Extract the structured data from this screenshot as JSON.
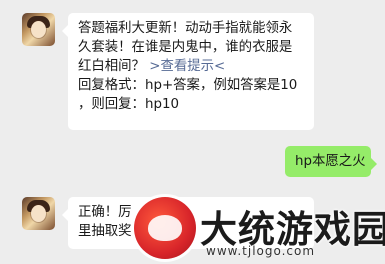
{
  "messages": [
    {
      "sender": "official",
      "lines": [
        "答题福利大更新！动动手指就能领永",
        "久套装！在谁是内鬼中，谁的衣服是",
        "红白相间？",
        "回复格式：hp+答案，例如答案是10",
        "，则回复：hp10"
      ],
      "link_text": ">查看提示<"
    },
    {
      "sender": "me",
      "text": "hp本愿之火"
    },
    {
      "sender": "official",
      "lines": [
        "正确！厉",
        "里抽取奖"
      ]
    }
  ],
  "watermark": {
    "title": "大统游戏园",
    "url": "www.tjlogo.com"
  },
  "colors": {
    "background": "#ededed",
    "incoming_bubble": "#ffffff",
    "outgoing_bubble": "#95ec69",
    "link": "#576b95"
  }
}
